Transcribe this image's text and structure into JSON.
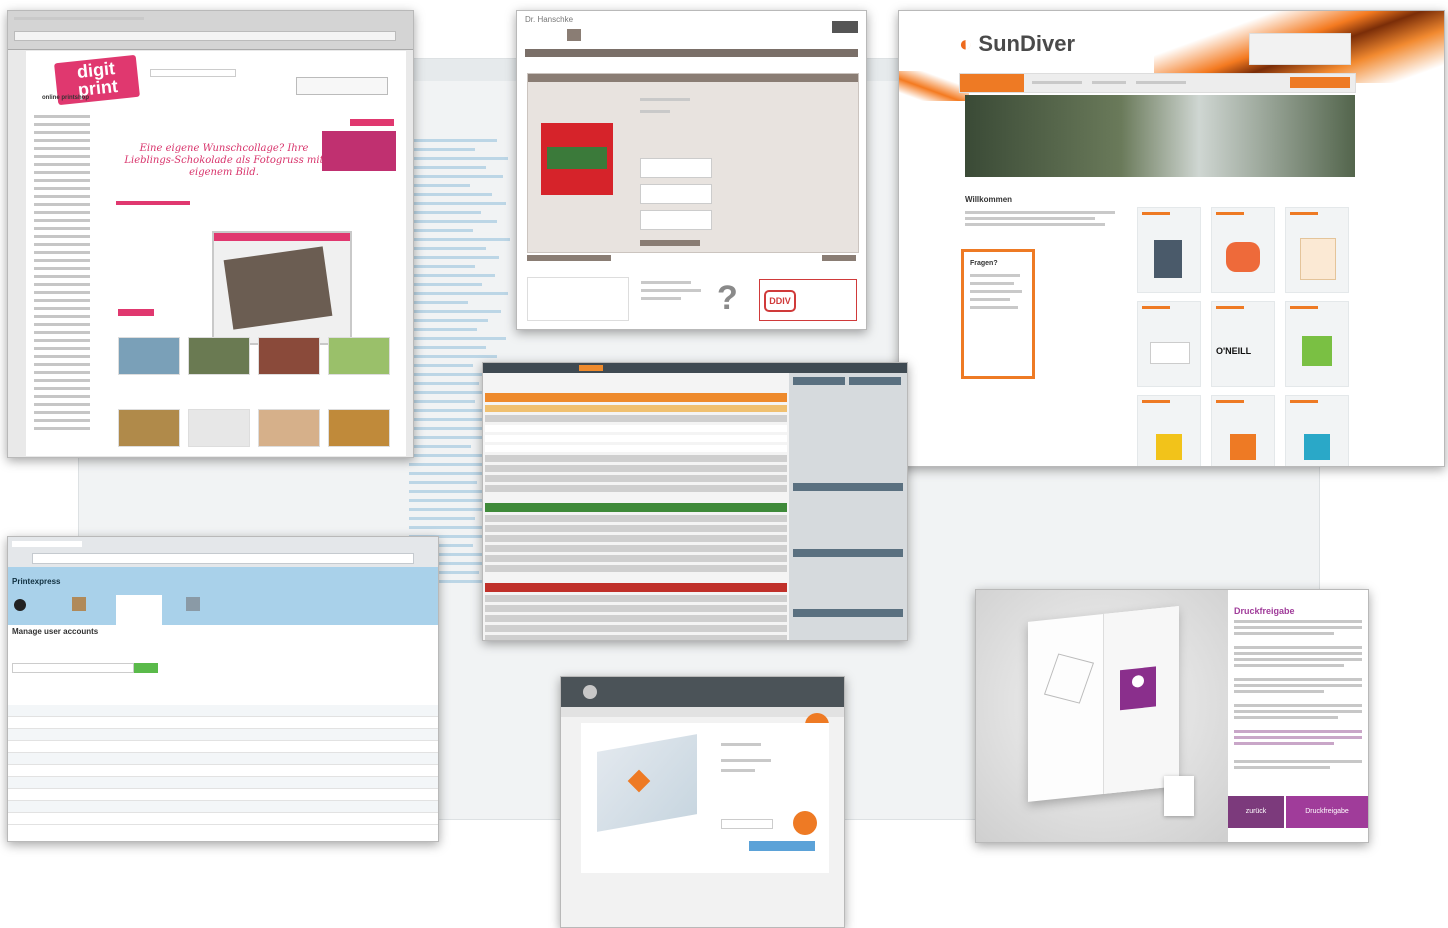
{
  "screens": {
    "digitprint": {
      "logo": "digit print",
      "tagline": "online printshop",
      "headline": "Eine eigene Wunschcollage? Ihre Lieblings-Schokolade als Fotogruss mit eigenem Bild."
    },
    "hanschke": {
      "title": "Dr. Hanschke",
      "badge_letters": "DDIV"
    },
    "sundiver": {
      "logo_main": "SunDiver",
      "welcome": "Willkommen",
      "fragen": "Fragen?",
      "brand_tile": "O'NEILL"
    },
    "printexpress": {
      "title": "Printexpress",
      "heading": "Manage user accounts"
    },
    "druckfreigabe": {
      "title": "Druckfreigabe",
      "btn_back": "zurück",
      "btn_release": "Druckfreigabe"
    }
  },
  "colors": {
    "digit_pink": "#e0386f",
    "sundiver_orange": "#ee7a24",
    "admin_orange": "#ee8a2c",
    "admin_green": "#3f8a3a",
    "admin_red": "#c0302a",
    "druck_purple": "#a03c9a",
    "printexpress_blue": "#a9d1ea"
  }
}
